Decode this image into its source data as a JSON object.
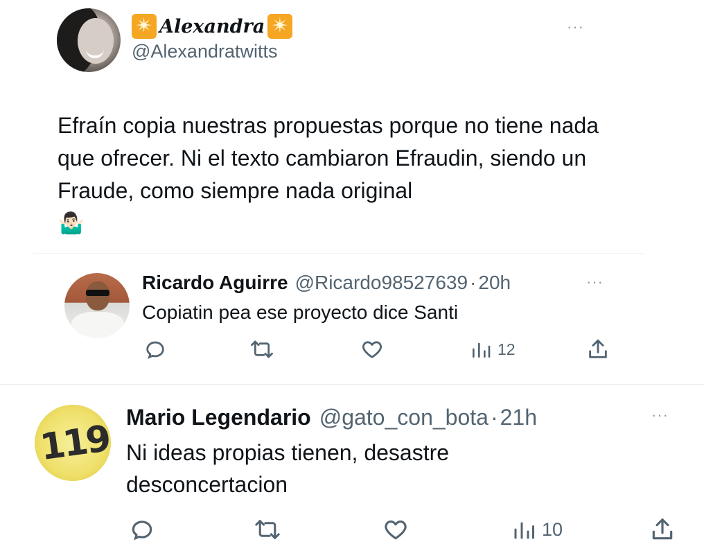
{
  "main_tweet": {
    "display_name": "Alexandra",
    "handle": "@Alexandratwitts",
    "more_label": "···",
    "text": "Efraín copia nuestras propuestas porque no tiene nada que ofrecer. Ni el texto cambiaron Efraudin, siendo un Fraude, como siempre nada original",
    "emoji": "🤷🏻‍♂️",
    "name_badge_glyph": "✴"
  },
  "replies": [
    {
      "name": "Ricardo Aguirre",
      "handle": "@Ricardo98527639",
      "separator": "·",
      "time": "20h",
      "text": "Copiatin pea ese proyecto dice Santi",
      "views": "12",
      "more_label": "···"
    },
    {
      "name": "Mario Legendario",
      "handle": "@gato_con_bota",
      "separator": "·",
      "time": "21h",
      "text": "Ni ideas propias tienen, desastre desconcertacion",
      "views": "10",
      "more_label": "···",
      "avatar_text": "119"
    }
  ],
  "icons": {
    "reply": "reply-icon",
    "retweet": "retweet-icon",
    "like": "like-icon",
    "views": "views-icon",
    "share": "share-icon"
  },
  "colors": {
    "text": "#0f1419",
    "secondary": "#536471",
    "divider": "#eff3f4",
    "badge": "#f5a623"
  }
}
